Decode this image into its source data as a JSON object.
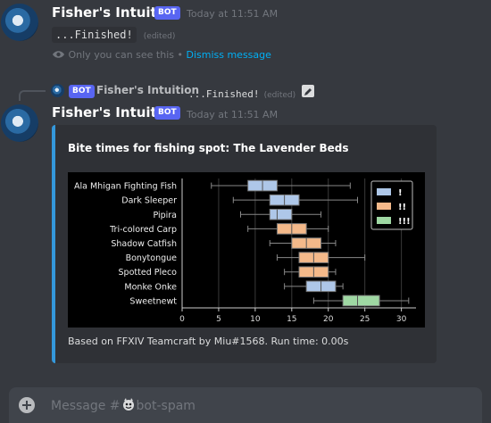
{
  "message1": {
    "username": "Fisher's Intuition",
    "bot_tag": "BOT",
    "timestamp": "Today at 11:51 AM",
    "content": "...Finished!",
    "edited": "(edited)",
    "ephemeral_note": "Only you can see this •",
    "dismiss_label": "Dismiss message"
  },
  "reply": {
    "bot_tag": "BOT",
    "username": "Fisher's Intuition",
    "content": "...Finished!",
    "edited": "(edited)"
  },
  "message2": {
    "username": "Fisher's Intuition",
    "bot_tag": "BOT",
    "timestamp": "Today at 11:51 AM",
    "embed": {
      "title": "Bite times for fishing spot: The Lavender Beds",
      "footer": "Based on FFXIV Teamcraft by Miu#1568. Run time: 0.00s",
      "accent_color": "#3498db"
    }
  },
  "input": {
    "placeholder_prefix": "Message #",
    "channel": "bot-spam"
  },
  "chart_data": {
    "type": "boxplot",
    "title": "",
    "xlabel": "",
    "ylabel": "",
    "xlim": [
      0,
      32
    ],
    "xticks": [
      0,
      5,
      10,
      15,
      20,
      25,
      30
    ],
    "grid": "vertical",
    "legend_position": "top-right",
    "legend": [
      {
        "label": "!",
        "color": "#aec7e8"
      },
      {
        "label": "!!",
        "color": "#f4b98a"
      },
      {
        "label": "!!!",
        "color": "#9fd8a3"
      }
    ],
    "series": [
      {
        "name": "Ala Mhigan Fighting Fish",
        "tug": "!",
        "min": 4,
        "q1": 9,
        "median": 11,
        "q3": 13,
        "max": 23
      },
      {
        "name": "Dark Sleeper",
        "tug": "!",
        "min": 7,
        "q1": 12,
        "median": 14,
        "q3": 16,
        "max": 24
      },
      {
        "name": "Pipira",
        "tug": "!",
        "min": 8,
        "q1": 12,
        "median": 13,
        "q3": 15,
        "max": 19
      },
      {
        "name": "Tri-colored Carp",
        "tug": "!!",
        "min": 9,
        "q1": 13,
        "median": 15,
        "q3": 17,
        "max": 20
      },
      {
        "name": "Shadow Catfish",
        "tug": "!!",
        "min": 12,
        "q1": 15,
        "median": 17,
        "q3": 19,
        "max": 21
      },
      {
        "name": "Bonytongue",
        "tug": "!!",
        "min": 13,
        "q1": 16,
        "median": 18,
        "q3": 20,
        "max": 25
      },
      {
        "name": "Spotted Pleco",
        "tug": "!!",
        "min": 14,
        "q1": 16,
        "median": 18,
        "q3": 20,
        "max": 21
      },
      {
        "name": "Monke Onke",
        "tug": "!",
        "min": 14,
        "q1": 17,
        "median": 19,
        "q3": 21,
        "max": 22
      },
      {
        "name": "Sweetnewt",
        "tug": "!!!",
        "min": 18,
        "q1": 22,
        "median": 24,
        "q3": 27,
        "max": 31
      }
    ]
  }
}
